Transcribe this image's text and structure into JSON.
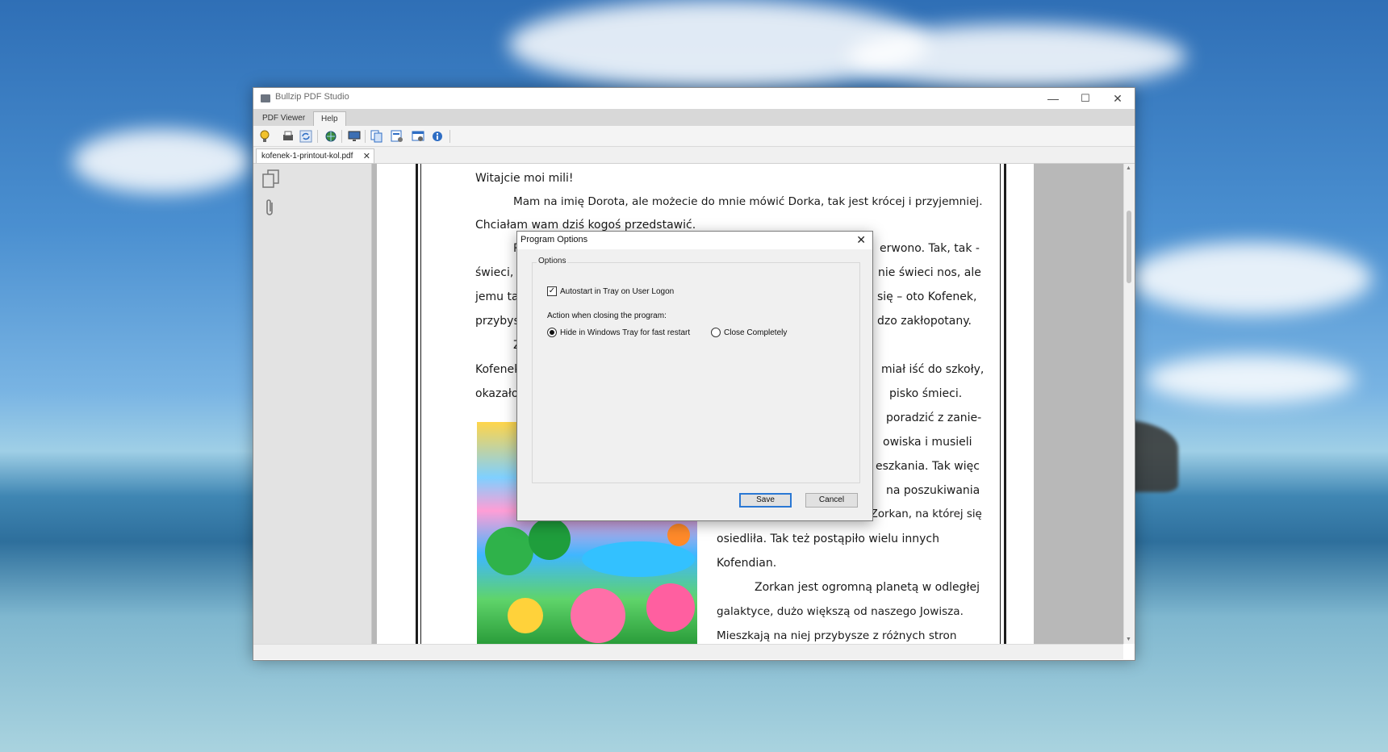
{
  "app": {
    "title": "Bullzip PDF Studio"
  },
  "window_controls": {
    "minimize": "—",
    "maximize": "☐",
    "close": "✕"
  },
  "ribbon_tabs": [
    {
      "label": "PDF Viewer"
    },
    {
      "label": "Help"
    }
  ],
  "doc_tab": {
    "label": "kofenek-1-printout-kol.pdf",
    "close": "✕"
  },
  "toolbar_icons": [
    "bulb-icon",
    "print-icon",
    "refresh-icon",
    "globe-icon",
    "monitor-icon",
    "pages-icon",
    "pages-settings-icon",
    "window-icon",
    "info-icon"
  ],
  "page": {
    "lines": [
      "Witajcie moi mili!",
      "Mam na imię Dorota, ale możecie do mnie mówić Dorka, tak jest krócej i przyjemniej.",
      "Chciałam wam dziś kogoś przedstawić.",
      "Po",
      "erwono. Tak, tak -",
      "świeci, w",
      "nie świeci nos, ale",
      "jemu tak",
      "się – oto Kofenek,",
      "przybysz",
      "dzo zakłopotany.",
      "Za",
      "Kofenek",
      "miał iść do szkoły,",
      "okazało s",
      "pisko śmieci.",
      "poradzić z zanie-",
      "owiska i musieli",
      "eszkania. Tak więc",
      "na poszukiwania",
      "i znalazła przyjazną planetę Zorkan, na której się",
      "osiedliła. Tak też postąpiło wielu innych",
      "Kofendian.",
      "Zorkan jest ogromną planetą w odległej",
      "galaktyce, dużo większą od naszego Jowisza.",
      "Mieszkają na niej przybysze z różnych stron"
    ]
  },
  "dialog": {
    "title": "Program Options",
    "close": "✕",
    "group_label": "Options",
    "autostart_label": "Autostart in Tray on User Logon",
    "autostart_checked": true,
    "action_label": "Action when closing the program:",
    "radio_hide_label": "Hide in Windows Tray for fast restart",
    "radio_close_label": "Close Completely",
    "selected_action": "hide",
    "save_label": "Save",
    "cancel_label": "Cancel"
  },
  "colors": {
    "accent": "#2a78d4",
    "dialog_bg": "#f0f0f0",
    "viewer_bg": "#b8b8b8"
  }
}
